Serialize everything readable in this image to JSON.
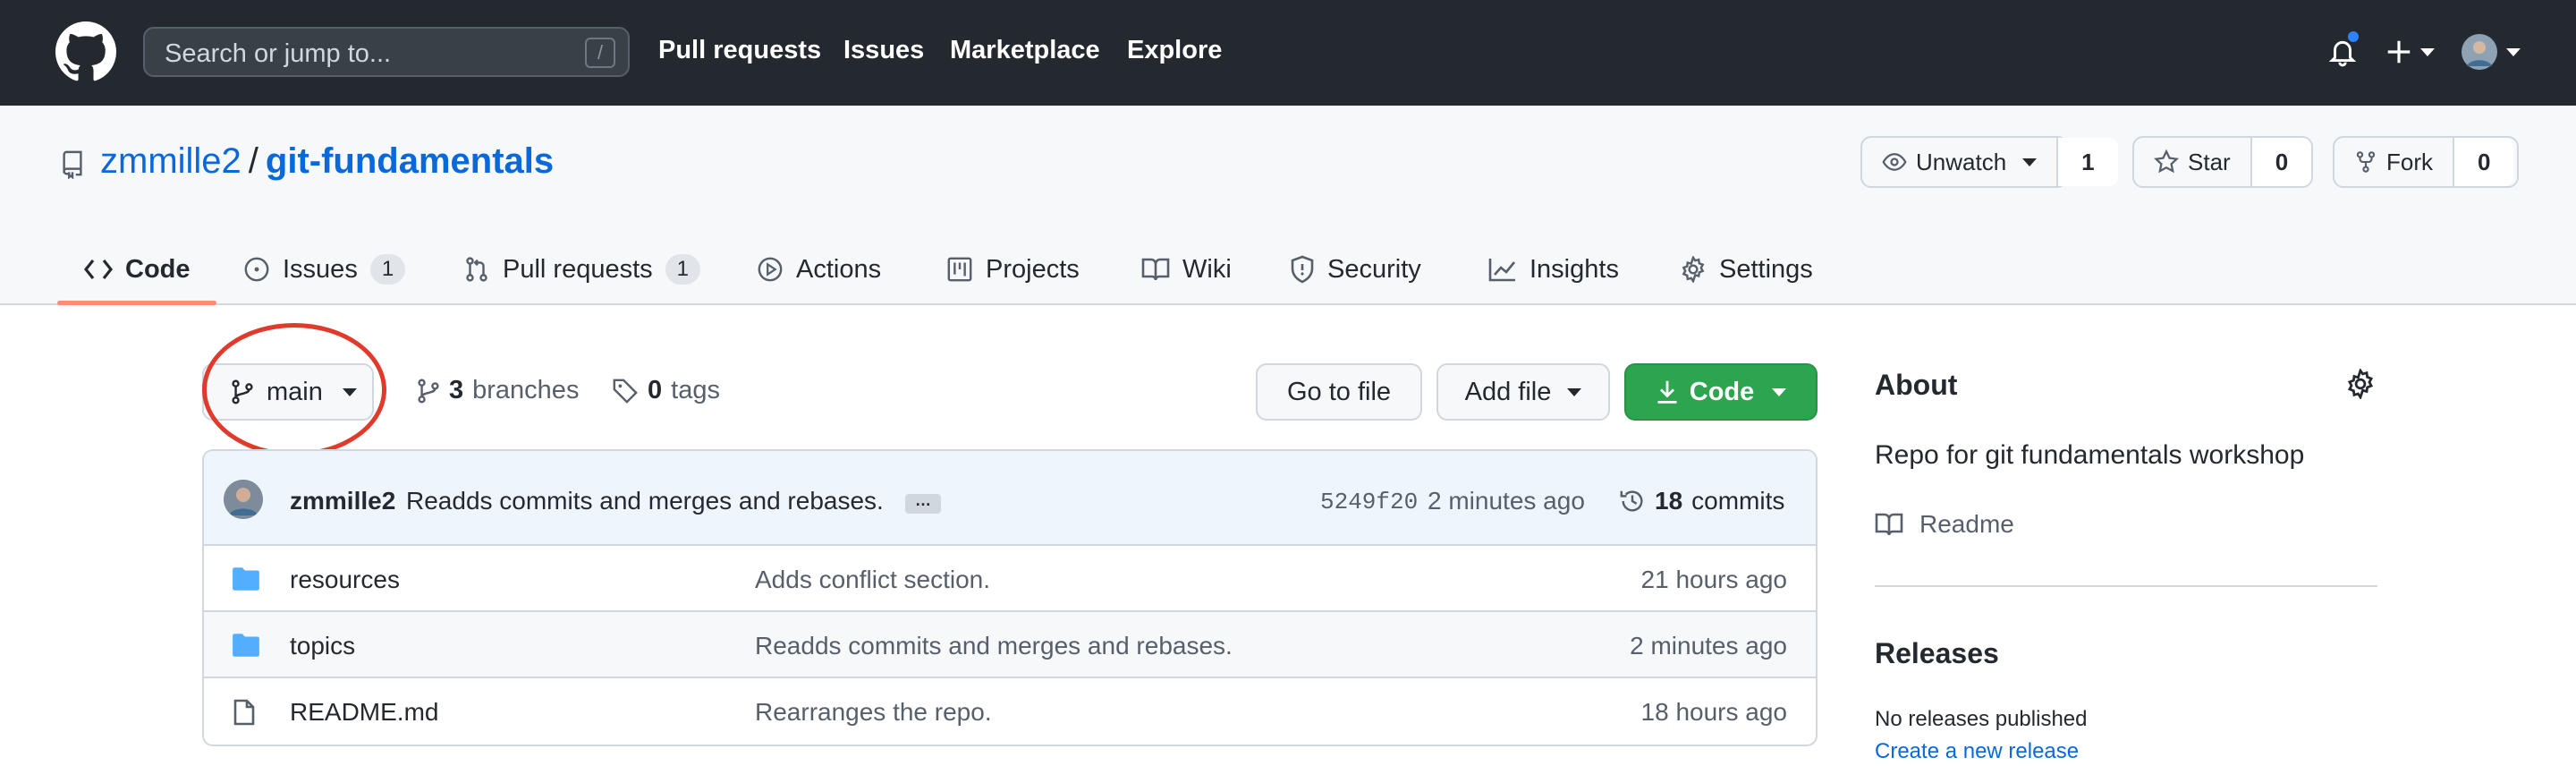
{
  "header": {
    "search_placeholder": "Search or jump to...",
    "search_key": "/",
    "nav": [
      "Pull requests",
      "Issues",
      "Marketplace",
      "Explore"
    ]
  },
  "repo": {
    "owner": "zmmille2",
    "separator": "/",
    "name": "git-fundamentals",
    "watch": {
      "label": "Unwatch",
      "count": "1"
    },
    "star": {
      "label": "Star",
      "count": "0"
    },
    "fork": {
      "label": "Fork",
      "count": "0"
    }
  },
  "tabs": [
    {
      "label": "Code",
      "icon": "code-icon"
    },
    {
      "label": "Issues",
      "count": "1",
      "icon": "issue-icon"
    },
    {
      "label": "Pull requests",
      "count": "1",
      "icon": "pull-request-icon"
    },
    {
      "label": "Actions",
      "icon": "play-icon"
    },
    {
      "label": "Projects",
      "icon": "project-icon"
    },
    {
      "label": "Wiki",
      "icon": "book-icon"
    },
    {
      "label": "Security",
      "icon": "shield-icon"
    },
    {
      "label": "Insights",
      "icon": "graph-icon"
    },
    {
      "label": "Settings",
      "icon": "gear-icon"
    }
  ],
  "branch": {
    "current": "main"
  },
  "meta": {
    "branches_count": "3",
    "branches_label": "branches",
    "tags_count": "0",
    "tags_label": "tags"
  },
  "actions": {
    "goto_file": "Go to file",
    "add_file": "Add file",
    "code": "Code"
  },
  "latest_commit": {
    "author": "zmmille2",
    "message": "Readds commits and merges and rebases.",
    "ellipsis": "…",
    "sha": "5249f20",
    "time": "2 minutes ago",
    "count": "18",
    "count_label": "commits"
  },
  "files": [
    {
      "name": "resources",
      "type": "folder",
      "message": "Adds conflict section.",
      "time": "21 hours ago"
    },
    {
      "name": "topics",
      "type": "folder",
      "message": "Readds commits and merges and rebases.",
      "time": "2 minutes ago"
    },
    {
      "name": "README.md",
      "type": "file",
      "message": "Rearranges the repo.",
      "time": "18 hours ago"
    }
  ],
  "about": {
    "title": "About",
    "description": "Repo for git fundamentals workshop",
    "readme": "Readme"
  },
  "releases": {
    "title": "Releases",
    "none": "No releases published",
    "create": "Create a new release"
  },
  "colors": {
    "header_bg": "#24292f",
    "link": "#0969da",
    "code_button": "#2da44e",
    "tab_underline": "#fd8c73",
    "annotation": "#e03a2c"
  }
}
